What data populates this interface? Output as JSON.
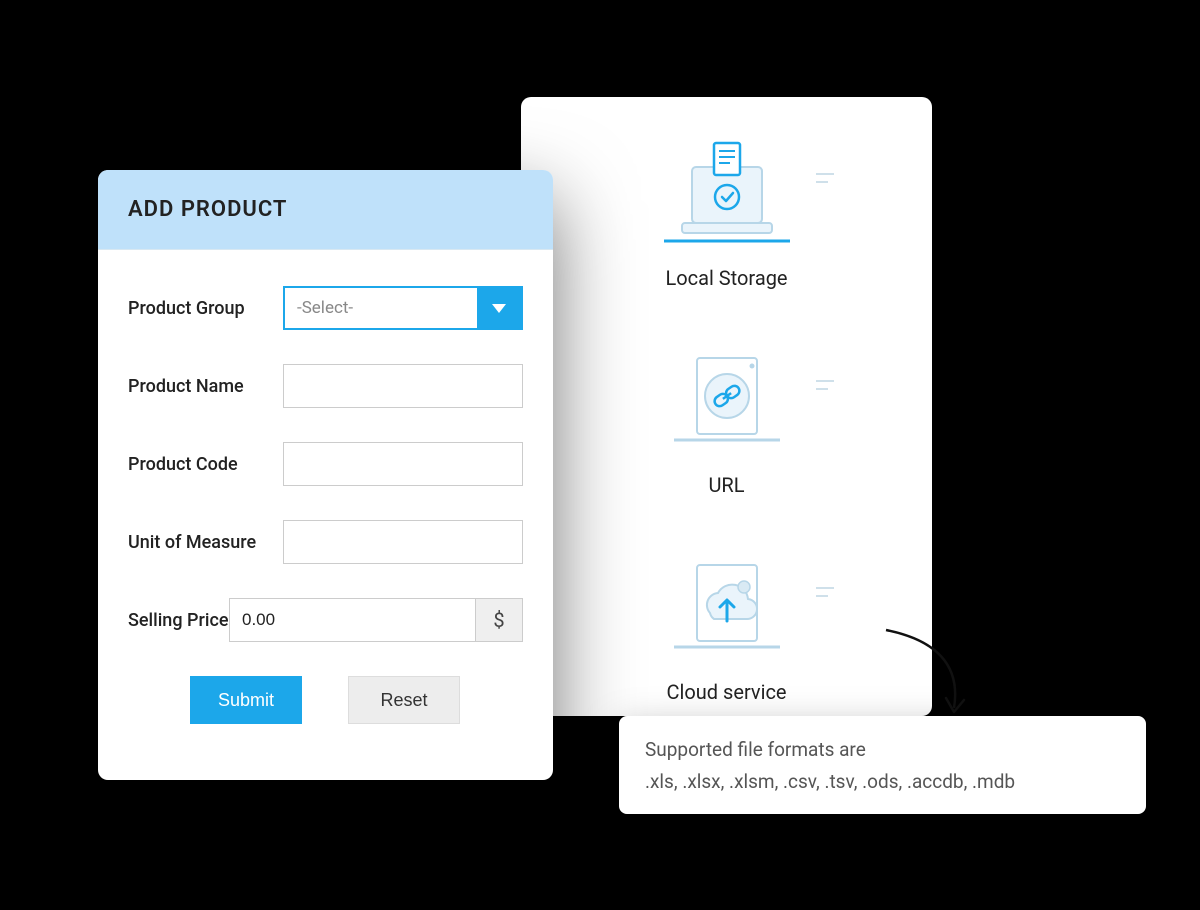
{
  "form": {
    "title": "ADD PRODUCT",
    "labels": {
      "product_group": "Product Group",
      "product_name": "Product Name",
      "product_code": "Product Code",
      "unit_of_measure": "Unit of Measure",
      "selling_price": "Selling Price"
    },
    "product_group_placeholder": "-Select-",
    "product_name_value": "",
    "product_code_value": "",
    "unit_of_measure_value": "",
    "selling_price_value": "0.00",
    "currency_symbol": "$",
    "submit_label": "Submit",
    "reset_label": "Reset"
  },
  "sources": {
    "local_storage": "Local Storage",
    "url": "URL",
    "cloud_service": "Cloud service"
  },
  "callout": {
    "line1": "Supported file formats are",
    "line2": ".xls, .xlsx, .xlsm, .csv, .tsv, .ods, .accdb, .mdb"
  },
  "colors": {
    "accent": "#1CA7EA",
    "header_bg": "#BFE1FA"
  }
}
